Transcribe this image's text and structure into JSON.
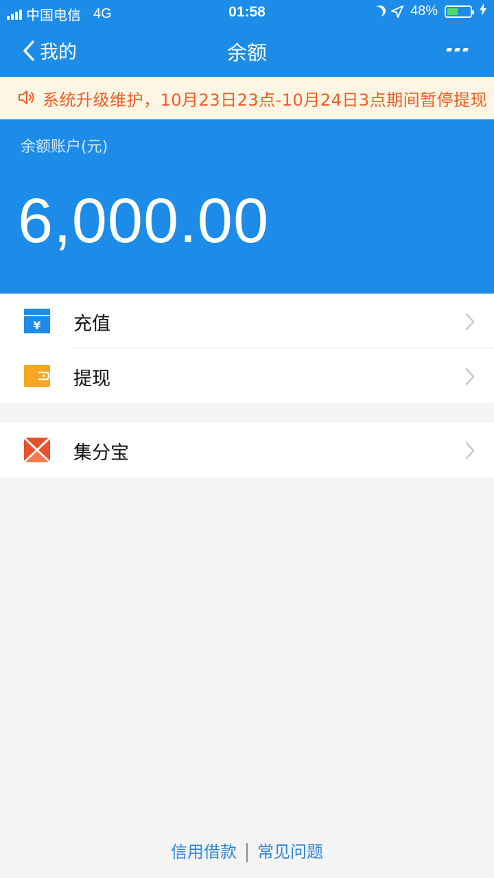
{
  "status_bar": {
    "carrier": "中国电信",
    "network": "4G",
    "time": "01:58",
    "battery_percent": "48%",
    "battery_level": 0.48
  },
  "nav": {
    "back_label": "我的",
    "title": "余额"
  },
  "notice": {
    "text": "系统升级维护，10月23日23点-10月24日3点期间暂停提现"
  },
  "balance": {
    "label": "余额账户(元)",
    "amount": "6,000.00"
  },
  "menu": {
    "recharge": {
      "label": "充值",
      "icon": "recharge-icon"
    },
    "withdraw": {
      "label": "提现",
      "icon": "wallet-icon"
    },
    "jifenbao": {
      "label": "集分宝",
      "icon": "jifenbao-icon"
    }
  },
  "footer": {
    "credit_loan": "信用借款",
    "faq": "常见问题"
  },
  "colors": {
    "primary": "#1c8ce8",
    "notice_bg": "#fef6e4",
    "notice_text": "#f35b23",
    "link": "#2f86d4",
    "battery_fill": "#4cd964"
  }
}
